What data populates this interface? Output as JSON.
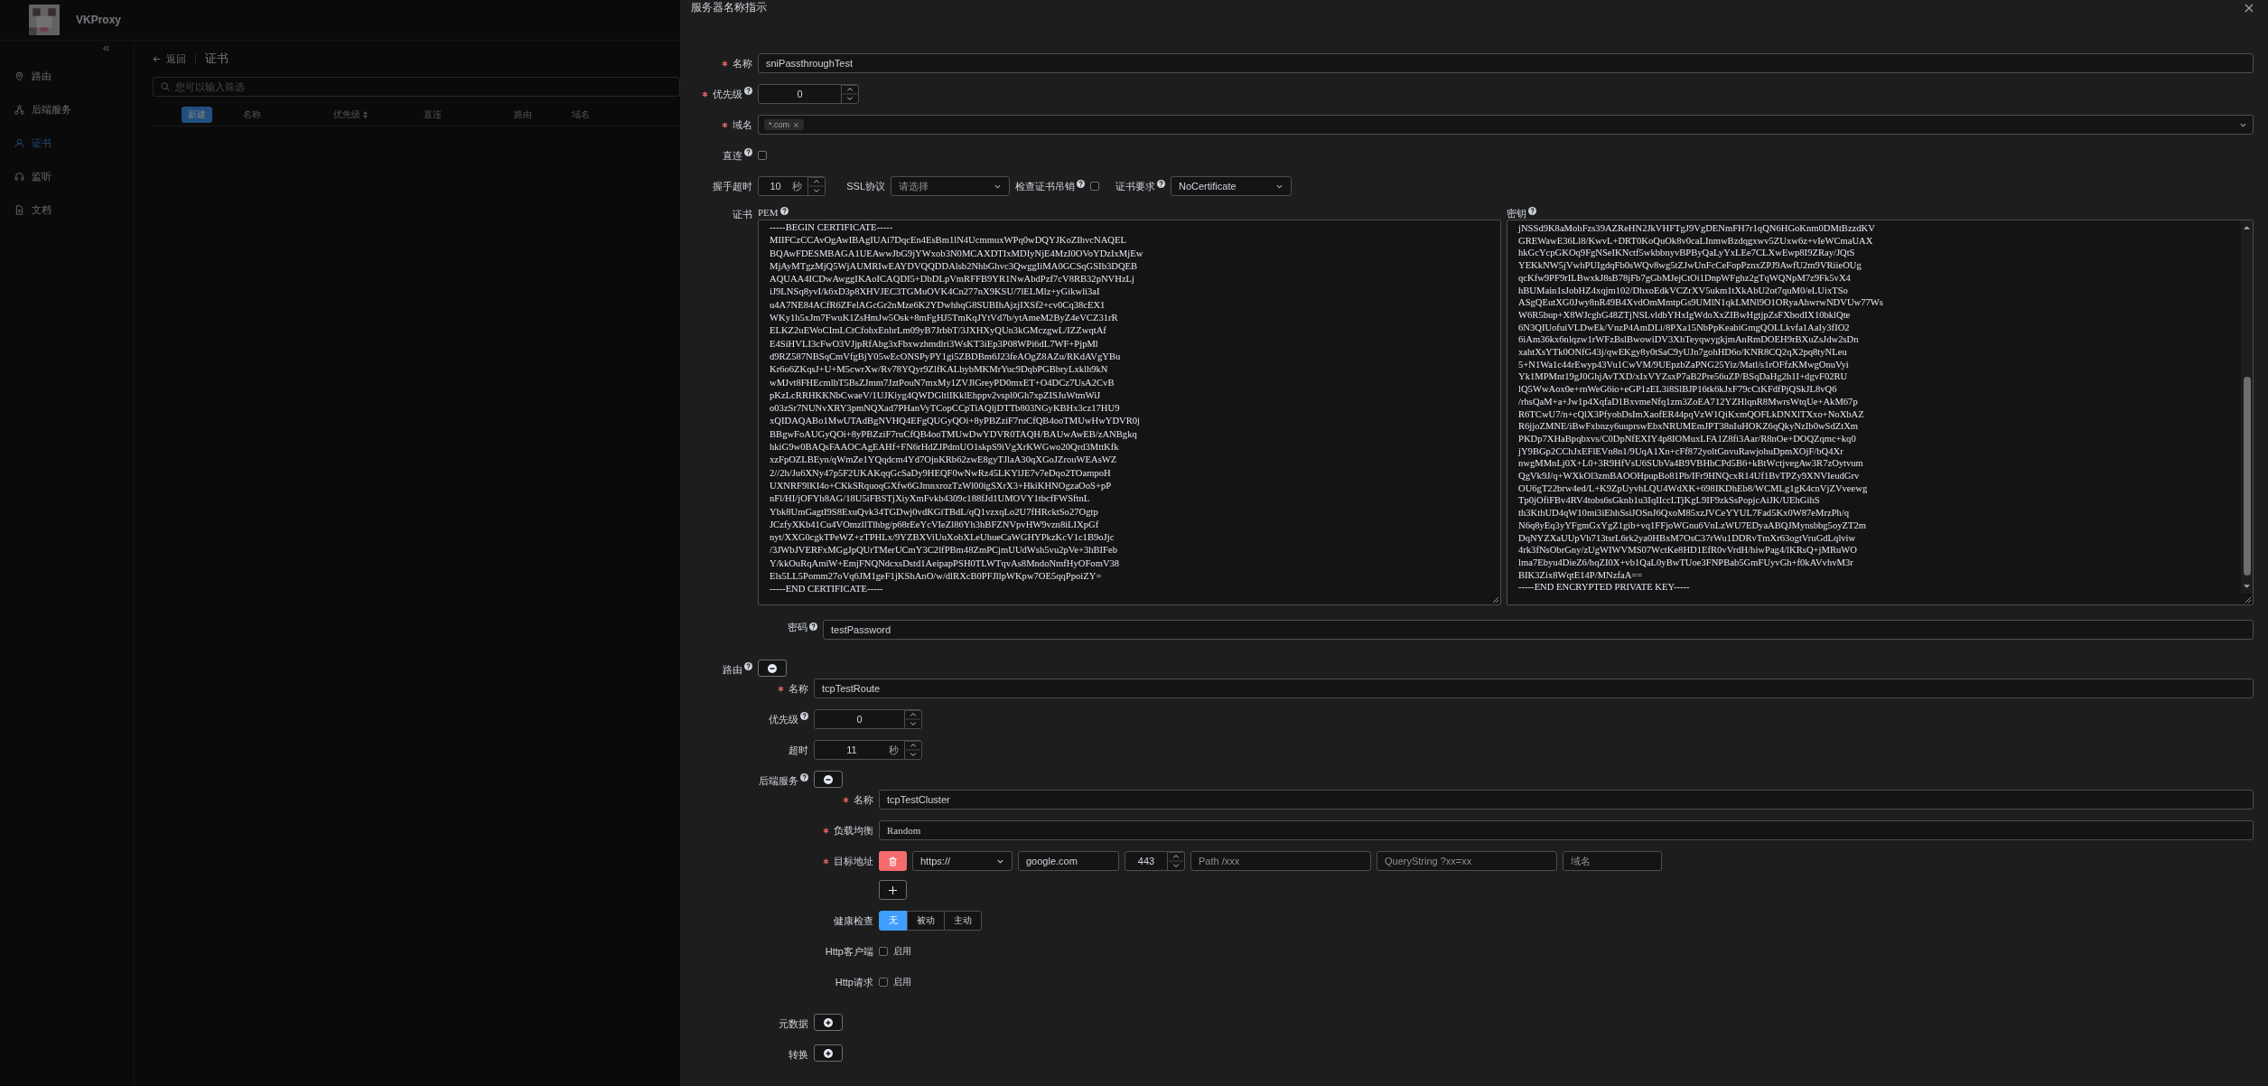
{
  "app": {
    "name": "VKProxy"
  },
  "sidebar": {
    "items": [
      {
        "label": "路由",
        "selected": false
      },
      {
        "label": "后端服务",
        "selected": false
      },
      {
        "label": "证书",
        "selected": true
      },
      {
        "label": "监听",
        "selected": false
      },
      {
        "label": "文档",
        "selected": false
      }
    ]
  },
  "page_header": {
    "back": "返回",
    "title": "证书"
  },
  "search": {
    "placeholder": "您可以输入筛选"
  },
  "table": {
    "new_button": "新建",
    "columns": [
      {
        "label": "名称",
        "sortable": false
      },
      {
        "label": "优先级",
        "sortable": true
      },
      {
        "label": "直连",
        "sortable": false
      },
      {
        "label": "路由",
        "sortable": false
      },
      {
        "label": "域名",
        "sortable": false
      }
    ]
  },
  "drawer": {
    "title": "服务器名称指示",
    "name": {
      "label": "名称",
      "required": true,
      "help": false,
      "value": "sniPassthroughTest"
    },
    "priority": {
      "label": "优先级",
      "required": true,
      "help": true,
      "value": "0"
    },
    "hosts": {
      "label": "域名",
      "required": true,
      "help": false,
      "tags": [
        "*.com"
      ]
    },
    "passthrough": {
      "label": "直连",
      "required": false,
      "help": true,
      "checked": false
    },
    "handshake_timeout": {
      "label": "握手超时",
      "required": false,
      "help": false,
      "value": "10",
      "unit": "秒"
    },
    "ssl_protocols": {
      "label": "SSL协议",
      "help": false,
      "placeholder": "请选择"
    },
    "check_revocation": {
      "label": "检查证书吊销",
      "help": true,
      "checked": false
    },
    "client_certificate": {
      "label": "证书要求",
      "help": true,
      "value": "NoCertificate"
    },
    "certificate": {
      "label": "证书",
      "required": false,
      "help": false,
      "pem": {
        "label": "PEM",
        "help": true,
        "value": "-----BEGIN CERTIFICATE-----\nMIIFCzCCAvOgAwIBAgIUAi7DqcEn4EsBm1lN4UcmmuxWPq0wDQYJKoZIhvcNAQEL\nBQAwFDESMBAGA1UEAwwJbG9jYWxob3N0MCAXDTIxMDIyNjE4MzI0OVoYDzIxMjEw\nMjAyMTgzMjQ5WjAUMRIwEAYDVQQDDAlsb2NhbGhvc3QwggIiMA0GCSqGSIb3DQEB\nAQUAA4ICDwAwggIKAoICAQDI5+DbDLpVmRFFB9YR1NwAbdPzf7cV8RB32pNVHzLj\niJ9LNSq8yvI/k6xD3p8XHVJEC3TGMuOVK4Cn277nX9KSU/7lELMlz+yGikwli3aI\nu4A7NE84ACfR6ZFelAGcGr2nMze6K2YDwhhqG8SUBIhAjzjIXSf2+cv0Cq38cEX1\nWKy1h5xJm7FwuK1ZsHmJw5Osk+8mFgHJ5TmKqJYtVd7b/ytAmeM2ByZ4eVCZ31rR\nELKZ2uEWoCImLCtCfohxEnhrLm09yB7JrbbT/3JXHXyQUn3kGMczgwL/IZZwqtAf\nE4SiHVLI3cFwO3VJjpRfAbg3xFbxwzhmdlri3WsKT3iEp3P08WPi6dL7WF+PjpMl\nd9RZ587NBSqCmVfgBjY05wEcONSPyPY1gi5ZBDBm6J23feAOgZ8AZu/RKdAVgYBu\nKr6o6ZKqsJ+U+M5cwrXw/Rv78YQyr9ZlfKALbybMKMrYuc9DqbPGBbryLxklh9kN\nwMJvt8FHEcmlbT5BsZJmm7JztPouN7mxMy1ZVJlGreyPD0mxET+O4DCz7UsA2CvB\npKzLcRRHKKNbCwaeV/1UJKiyg4QWDGltlIKklEhppv2vspl0Gh7xpZISJuWtmWiJ\no03zSr7NUNvXRY3pmNQXad7PHanVyTCopCCpTiAQljDTTb803NGyKBHx3cz17HU9\nxQIDAQABo1MwUTAdBgNVHQ4EFgQUGyQOi+8yPBZziF7ruCfQB4ooTMUwHwYDVR0j\nBBgwFoAUGyQOi+8yPBZziF7ruCfQB4ooTMUwDwYDVR0TAQH/BAUwAwEB/zANBgkq\nhkiG9w0BAQsFAAOCAgEAHf+FN6rHdZJPdmUO1skpS9iVgXrKWGwo20Qrd3MttKfk\nxzFpOZLBEyn/qWmZe1YQqdcm4Yd7OjnKRb62zwE8gyTJlaA30qXGoJZrouWEAsWZ\n2//2h/Ju6XNy47p5F2UKAKqqGcSaDy9HEQF0wNwRz45LKYlJE7v7eDqo2TOampoH\nUXNRF9lKI4o+CKkSRquoqGXfw6GJmnxrozTzWl00igSXrX3+HkiKHNOgzaOoS+pP\nnFl/HI/jOFYh8AG/18U5iFBSTjXiyXmFvkb4309c188fJd1UMOVY1tbcfFWSftnL\nYbk8UmGagtI9S8ExuQvk34TGDwj0vdKGiTBdL/qQ1vzxqLo2U7fHRcktSo27Ogtp\nJCzfyXKb41Cu4VOmzllTlhbg/p68rEeYcVIeZl86Yh3hBFZNVpvHW9vzn8iLIXpGf\nnyt/XXG0cgkTPeWZ+zTPHLx/9YZBXViUuXobXLeUhueCaWGHYPkzKcV1c1B9oJjc\n/3JWbJVERFxMGgJpQUrTMerUCmY3C2lfPBm48ZmPCjmUUdWsh5vu2pVe+3hBIFeb\nY/kkOuRqAmiW+EmjFNQNdcxsDstd1AeipapPSH0TLWTqvAs8MndoNmfHyOFomV38\nEls5LL5Pomm27oVq6JM1geF1jKShAnO/w/dlRXcB0PFJllpWKpw7OE5qqPpoiZY=\n-----END CERTIFICATE-----"
      },
      "key": {
        "label": "密钥",
        "help": true,
        "value": "jNSSd9K8aMohFzs39AZReHN2JkVHFTgJ9VgDENmFH7r1qQN6HGoKnm0DMtBzzdKV\nGREWawE36Ll8/KwvL+DRT0KoQuOk8v0caLInmwBzdqgxwv5ZUxw6z+vIeWCmaUAX\nhkGcYcpGKOq9FgNSeIKNctf5wkbbnyvBPByQaLyYxLEe7CLXwEwp8I9ZRay/JQtS\nYEKkNW5jVwhPUIgdqFb0sWQv8wg5tZJwUnFcCeFopPznxZPJ9AwfU2m9VRiieOUg\nqcKfw9PF9rILBwxkJ8sB78jFb7gGbMJejCtOi1DnpWFghz2gTqWQNpM7z9Fk5vX4\nhBUMain1sJobHZ4xqjm102/DhxoEdkVCZrXV5ukm1tXkAbU2ot7quM0/eLUixTSo\nASgQEutXG0Jwy8nR49B4XvdOmMmtpGs9UMlN1qkLMNl9O1ORyaAhwrwNDVUw77Ws\nW6R5bup+X8WJcghG48ZTjNSLvldbYHxIgWdoXxZIBwHgtjpZsFXbodIX10bklQte\n6N3QIUofuiVLDwEk/VnzP4AmDLi/8PXa15NbPpKeabiGmgQOLLkvfa1AaIy3fIO2\n6iAm36kx6nlqzw1rWFzBslBwowiDV3XhTeyqwygkjmAnRmDOEH9rBXuZsJdw2sDn\nxahtXsYTk0ONfG43j/qwEKgy8y0tSaC9yUJn7gohHD6o/KNR8CQ2qX2pq8tyNLeu\n5+N1Wa1c44rEwyp43Vu1CwVM/9UEpzbZaPNG25Yiz/Matl/s1rOFfzKMwgOnuVyi\nYk1MPMnt19gJ0GhjAvTXD/xIxVYZsxP7aB2Pre56uZP/BSqDaHg2h1I+dgvF02RU\nlQ5WwAox0e+rnWeG6io+eGP1zEL3i8SlBJP16tk6kJxF79cCtKFdfPjQSkJL8vQ6\n/rhsQaM+a+Jw1p4XqfaD1BxvmeNfq1zm3ZoEA712YZHlqnR8MwrsWtqUe+AkM67p\nR6TCwU7/n+cQlX3PfyobDsImXaofER44pqVzW1QiKxmQOFLkDNXlTXxo+NoXbAZ\nR6jjoZMNE/iBwFxbnzy6uuprswEbxNRUMEmJPT38nIuHOKZ6qQkyNzIb0wSdZtXm\nPKDp7XHaBpqbxvs/C0DpNfEXIY4p8IOMuxLFA1Z8fi3Aar/R8nOe+DOQZqmc+kq0\njY9BGp2CChJxEFlEVn8n1/9UqA1Xn+cFf872yoltGnvuRawjohuDpmXOjF/bQ4Xr\nnwgMMnLj0X+L0+3R9HfVsU6SUbVa4B9VBHhCPd5B6+kBtWctjvegAw3R7zOytvum\nQgVk9J/q+WXkOl3zmBAOOHpupBo81Pb/IFr9HNQcxR14Uf1BvTPZy9XNVIeudGrv\nOU6gT22brw4ed/L+K9ZpUyvhLQU4WdXK+698IKDhEb8/WCMLg1gK4cnVjZVveewg\nTp0jOfiFBv4RV4tobs6sGknb1u3IqIIccLTjKgL9IF9zkSsPopjcAiJK/UEhGihS\nth3KthUD4qW10mi3iEhhSsiJOSnJ6QxoM85xzJVCeYYUL7Fad5Kx0W87eMrzPh/q\nN6q8yEq3yYFgmGxYgZ1gib+vq1FFjoWGnu6VnLzWU7EDyaABQJMynsbbg5oyZT2m\nDqNYZXaUUpVh713tsrL6rk2ya0HBxM7OsC37rWu1DDRvTmXr63ogtVruGdLqlviw\n4rk3fNsObrGny/zUgWIWVMS07WctKe8HD1EfR0vVrdH/hiwPag4/lKRsQ+jMRuWO\nlma7Ebyu4DieZ6/hqZI0X+vb1QaL0yBwTUoe3FNPBab5GmFUyvGh+f0kAVvhvM3r\nBIK3Zix8WqtE14P/MNzfaA==\n-----END ENCRYPTED PRIVATE KEY-----"
      },
      "password": {
        "label": "密码",
        "help": true,
        "value": "testPassword"
      }
    },
    "route": {
      "label": "路由",
      "help": true,
      "name": {
        "label": "名称",
        "required": true,
        "help": false,
        "value": "tcpTestRoute"
      },
      "priority": {
        "label": "优先级",
        "required": false,
        "help": true,
        "value": "0"
      },
      "timeout": {
        "label": "超时",
        "required": false,
        "help": false,
        "value": "11",
        "unit": "秒"
      },
      "cluster": {
        "label": "后端服务",
        "help": true,
        "name": {
          "label": "名称",
          "required": true,
          "help": false,
          "value": "tcpTestCluster"
        },
        "load_balancing": {
          "label": "负载均衡",
          "required": true,
          "help": false,
          "value": "Random"
        },
        "destinations": {
          "label": "目标地址",
          "required": true,
          "help": false,
          "items": [
            {
              "scheme": "https://",
              "host": "google.com",
              "port": "443",
              "path_placeholder": "Path /xxx",
              "query_placeholder": "QueryString ?xx=xx",
              "host_placeholder": "域名"
            }
          ]
        },
        "health_check": {
          "label": "健康检查",
          "required": false,
          "help": false,
          "options": [
            {
              "label": "无",
              "selected": true
            },
            {
              "label": "被动",
              "selected": false
            },
            {
              "label": "主动",
              "selected": false
            }
          ]
        },
        "http_client": {
          "label": "Http客户端",
          "required": false,
          "help": false,
          "option": "启用",
          "checked": false
        },
        "http_request": {
          "label": "Http请求",
          "required": false,
          "help": false,
          "option": "启用",
          "checked": false
        }
      },
      "metadata": {
        "label": "元数据",
        "required": false,
        "help": false
      },
      "transforms": {
        "label": "转换",
        "required": false,
        "help": false
      }
    }
  }
}
